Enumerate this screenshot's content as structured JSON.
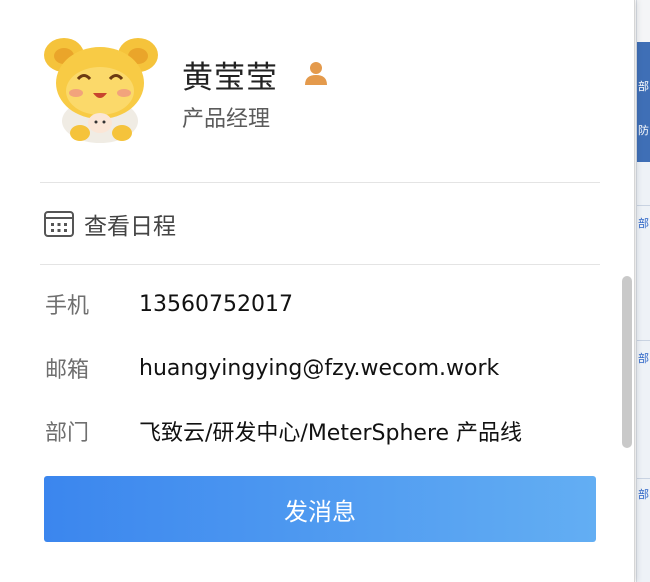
{
  "profile": {
    "name": "黄莹莹",
    "job_title": "产品经理",
    "avatar_icon": "cartoon-bear-avatar",
    "person_icon": "person-icon"
  },
  "actions": {
    "schedule_label": "查看日程",
    "send_message_label": "发消息"
  },
  "details": [
    {
      "key": "手机",
      "value": "13560752017"
    },
    {
      "key": "邮箱",
      "value": "huangyingying@fzy.wecom.work"
    },
    {
      "key": "部门",
      "value": "飞致云/研发中心/MeterSphere 产品线"
    }
  ],
  "background_fragments": [
    "部",
    "防",
    "部",
    "部",
    "部"
  ],
  "colors": {
    "button_start": "#3b86ee",
    "button_end": "#63aef3",
    "person_icon": "#e49a4c"
  }
}
